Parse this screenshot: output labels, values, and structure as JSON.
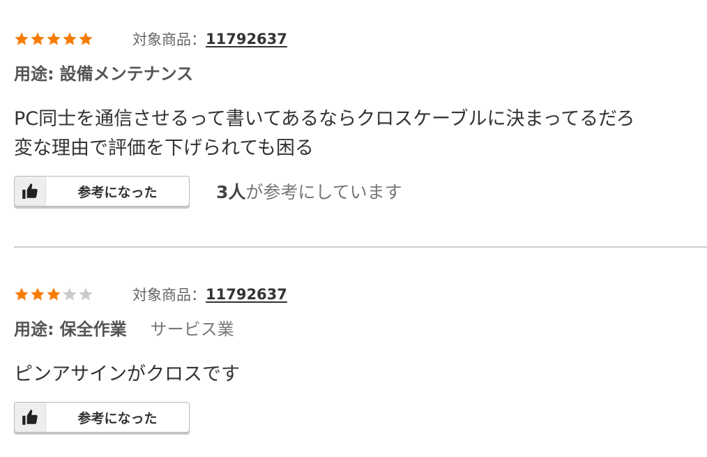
{
  "colors": {
    "star_filled": "#f57c00",
    "star_empty": "#cccccc",
    "divider": "#cccccc"
  },
  "reviews": [
    {
      "rating": 5,
      "max_rating": 5,
      "product_label": "対象商品：",
      "product_id": "11792637",
      "usage_prefix": "用途:",
      "usage_value": "設備メンテナンス",
      "industry": "",
      "comment_lines": [
        "PC同士を通信させるって書いてあるならクロスケーブルに決まってるだろ",
        "変な理由で評価を下げられても困る"
      ],
      "helpful_button_label": "参考になった",
      "helpful_count_num": "3人",
      "helpful_count_text": "が参考にしています",
      "thumb_icon": "thumbs-up-icon"
    },
    {
      "rating": 3,
      "max_rating": 5,
      "product_label": "対象商品：",
      "product_id": "11792637",
      "usage_prefix": "用途:",
      "usage_value": "保全作業",
      "industry": "サービス業",
      "comment_lines": [
        "ピンアサインがクロスです"
      ],
      "helpful_button_label": "参考になった",
      "helpful_count_num": "",
      "helpful_count_text": "",
      "thumb_icon": "thumbs-up-icon"
    }
  ]
}
